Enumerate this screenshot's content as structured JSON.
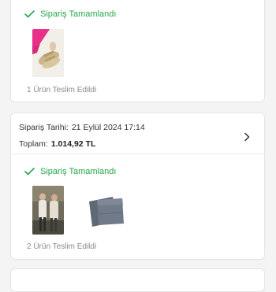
{
  "colors": {
    "status_green": "#25a74a",
    "muted_text": "#8a8a8a",
    "background": "#f4f4f4"
  },
  "orders": [
    {
      "status": "Sipariş Tamamlandı",
      "status_icon": "check-icon",
      "delivered_text": "1 Ürün Teslim Edildi"
    },
    {
      "date_label": "Sipariş Tarihi:",
      "date_value": "21 Eylül 2024 17:14",
      "total_label": "Toplam:",
      "total_value": "1.014,92 TL",
      "chevron_icon": "chevron-right-icon",
      "status": "Sipariş Tamamlandı",
      "status_icon": "check-icon",
      "delivered_text": "2 Ürün Teslim Edildi"
    }
  ]
}
